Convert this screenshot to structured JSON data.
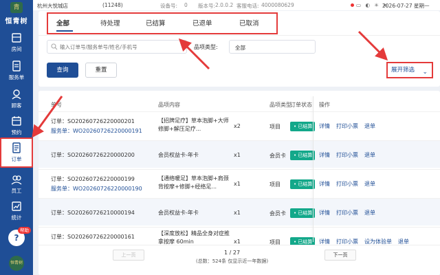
{
  "status_bar": {
    "store": "杭州大悦城店",
    "store_id": "(11248)",
    "device_label": "设备号:",
    "device_value": "0",
    "version_label": "版本号:",
    "version_value": "2.0.0.2",
    "hotline_label": "客服电话:",
    "hotline_value": "4000080629",
    "datetime": "2026-07-27 星期一"
  },
  "brand": {
    "name": "恒青树",
    "mark": "青"
  },
  "sidebar": {
    "items": [
      {
        "label": "房间",
        "icon": "room-icon"
      },
      {
        "label": "服务单",
        "icon": "service-order-icon"
      },
      {
        "label": "顾客",
        "icon": "customer-icon"
      },
      {
        "label": "预约",
        "icon": "calendar-icon"
      },
      {
        "label": "订单",
        "icon": "order-icon"
      },
      {
        "label": "员工",
        "icon": "staff-icon"
      },
      {
        "label": "统计",
        "icon": "stats-icon"
      }
    ],
    "help_badge": "帮助",
    "bottom_logo": "恒青树"
  },
  "tabs": [
    {
      "label": "全部"
    },
    {
      "label": "待处理"
    },
    {
      "label": "已结算"
    },
    {
      "label": "已退单"
    },
    {
      "label": "已取消"
    }
  ],
  "filters": {
    "search_placeholder": "输入订单号/服务单号/姓名/手机号",
    "category_label": "品项类型:",
    "category_value": "全部",
    "query_label": "查询",
    "reset_label": "重置",
    "expand_label": "展开筛选"
  },
  "table": {
    "headers": {
      "order": "单号",
      "content": "品项内容",
      "type": "品项类型",
      "status": "订单状态",
      "ops": "操作"
    },
    "rows": [
      {
        "order": "订单：SO20260726220000201",
        "service": "服务单：WO20260726220000191",
        "content": "【招牌足疗】草本泡脚+大师修脚+解压足疗...",
        "qty": "x2",
        "type": "项目",
        "status": "• 已结算",
        "ops": [
          "详情",
          "打印小票",
          "退单"
        ]
      },
      {
        "order": "订单：SO20260726220000200",
        "service": "",
        "content": "会员权益卡-年卡",
        "qty": "x1",
        "type": "会员卡",
        "status": "• 已结算",
        "ops": [
          "详情",
          "打印小票",
          "退单"
        ]
      },
      {
        "order": "订单：SO20260726220000199",
        "service": "服务单：WO20260726220000190",
        "content": "【通络暖足】草本泡脚+肩颈背按摩+修脚+经络足...",
        "qty": "x1",
        "type": "项目",
        "status": "• 已结算",
        "ops": [
          "详情",
          "打印小票",
          "退单"
        ]
      },
      {
        "order": "订单：SO20260726210000194",
        "service": "",
        "content": "会员权益卡-年卡",
        "qty": "x1",
        "type": "会员卡",
        "status": "• 已结算",
        "ops": [
          "详情",
          "打印小票",
          "退单"
        ]
      },
      {
        "order": "订单：SO20260726220000161",
        "service": "",
        "content": "【深度放松】精品全身对症推拿按摩 60min",
        "qty": "x1",
        "type": "项目",
        "status": "• 已结算",
        "ops": [
          "详情",
          "打印小票",
          "设为体验单",
          "退单"
        ]
      }
    ]
  },
  "pager": {
    "prev": "上一页",
    "next": "下一页",
    "page": "1 / 27",
    "total": "(总数：524条 仅显示近一年数据)"
  },
  "colors": {
    "primary": "#1f4e96",
    "success": "#13a88a",
    "annotation": "#e43a3a"
  }
}
